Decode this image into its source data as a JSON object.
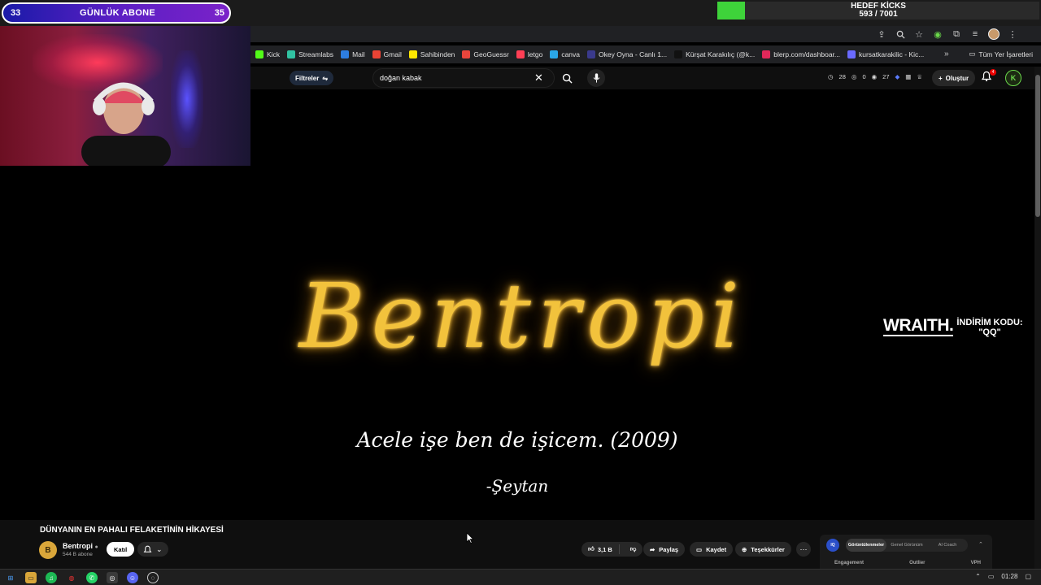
{
  "overlay": {
    "sub_goal": {
      "current": "33",
      "label": "GÜNLÜK ABONE",
      "target": "35"
    },
    "kicks_goal": {
      "label": "HEDEF KİCKS",
      "value": "593 / 7001",
      "progress": 0.085,
      "color": "#3ed33a"
    }
  },
  "bookmarks": {
    "items": [
      {
        "label": "Kick",
        "color": "#53fc18"
      },
      {
        "label": "Streamlabs",
        "color": "#31c3a2"
      },
      {
        "label": "Mail",
        "color": "#2d7de0"
      },
      {
        "label": "Gmail",
        "color": "#ea4335"
      },
      {
        "label": "Sahibinden",
        "color": "#ffe800"
      },
      {
        "label": "GeoGuessr",
        "color": "#e8453c"
      },
      {
        "label": "letgo",
        "color": "#ff3f55"
      },
      {
        "label": "canva",
        "color": "#2aa7e8"
      },
      {
        "label": "Okey Oyna - Canlı 1...",
        "color": "#3a3a8c"
      },
      {
        "label": "Kürşat Karakılıç (@k...",
        "color": "#111111"
      },
      {
        "label": "blerp.com/dashboar...",
        "color": "#e0285a"
      },
      {
        "label": "kursatkarakilic - Kic...",
        "color": "#6a6aff"
      }
    ],
    "all_label": "Tüm Yer İşaretleri"
  },
  "header": {
    "filters_label": "Filtreler",
    "search_value": "doğan kabak",
    "stats": {
      "a": "28",
      "b": "0",
      "c": "27"
    },
    "create_label": "Oluştur",
    "notif_count": "4",
    "avatar_letter": "K"
  },
  "video": {
    "title_art": "Bentropi",
    "quote": "Acele işe ben de işicem. (2009)",
    "quote_author": "-Şeytan",
    "sponsor_logo": "WRAITH.",
    "sponsor_code_label": "İNDİRİM KODU:",
    "sponsor_code": "\"QQ\""
  },
  "watch": {
    "title": "DÜNYANIN EN PAHALI FELAKETİNİN HİKAYESİ",
    "channel_name": "Bentropi",
    "channel_initial": "B",
    "subscribers": "544 B abone",
    "join_label": "Katıl",
    "likes": "3,1 B",
    "share_label": "Paylaş",
    "save_label": "Kaydet",
    "thanks_label": "Teşekkürler"
  },
  "extension": {
    "logo": "IQ",
    "tabs": [
      "Görüntülenmeler",
      "Genel Görünüm",
      "AI Coach"
    ],
    "metrics": [
      "Engagement",
      "Outlier",
      "VPH"
    ]
  },
  "taskbar": {
    "time": "01:28"
  }
}
